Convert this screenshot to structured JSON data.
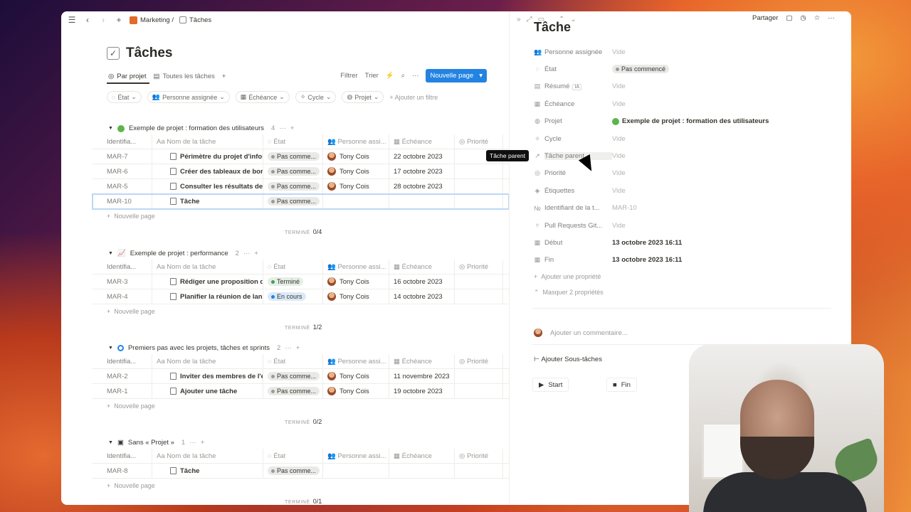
{
  "topbar": {
    "crumb1": "Marketing /",
    "crumb2": "Tâches",
    "share": "Partager"
  },
  "page": {
    "title": "Tâches"
  },
  "views": {
    "tab1": "Par projet",
    "tab2": "Toutes les tâches",
    "filter": "Filtrer",
    "sort": "Trier",
    "new_page": "Nouvelle page"
  },
  "filters": [
    "État",
    "Personne assignée",
    "Échéance",
    "Cycle",
    "Projet"
  ],
  "add_filter": "Ajouter un filtre",
  "columns": {
    "id": "Identifia...",
    "name": "Nom de la tâche",
    "state": "État",
    "person": "Personne assi...",
    "due": "Échéance",
    "priority": "Priorité"
  },
  "new_page_label": "Nouvelle page",
  "done_label": "TERMINÉ",
  "groups": [
    {
      "name": "Exemple de projet : formation des utilisateurs",
      "count": "4",
      "done": "0/4",
      "rows": [
        {
          "id": "MAR-7",
          "name": "Périmètre du projet d'infobu",
          "state": "Pas comme...",
          "person": "Tony Cois",
          "due": "22 octobre 2023"
        },
        {
          "id": "MAR-6",
          "name": "Créer des tableaux de bord",
          "state": "Pas comme...",
          "person": "Tony Cois",
          "due": "17 octobre 2023"
        },
        {
          "id": "MAR-5",
          "name": "Consulter les résultats de la",
          "state": "Pas comme...",
          "person": "Tony Cois",
          "due": "28 octobre 2023"
        },
        {
          "id": "MAR-10",
          "name": "Tâche",
          "state": "Pas comme...",
          "person": "",
          "due": ""
        }
      ]
    },
    {
      "name": "Exemple de projet : performance",
      "count": "2",
      "done": "1/2",
      "rows": [
        {
          "id": "MAR-3",
          "name": "Rédiger une proposition de",
          "state": "Terminé",
          "person": "Tony Cois",
          "due": "16 octobre 2023"
        },
        {
          "id": "MAR-4",
          "name": "Planifier la réunion de lance",
          "state": "En cours",
          "person": "Tony Cois",
          "due": "14 octobre 2023"
        }
      ]
    },
    {
      "name": "Premiers pas avec les projets, tâches et sprints",
      "count": "2",
      "done": "0/2",
      "rows": [
        {
          "id": "MAR-2",
          "name": "Inviter des membres de l'éq",
          "state": "Pas comme...",
          "person": "Tony Cois",
          "due": "11 novembre 2023"
        },
        {
          "id": "MAR-1",
          "name": "Ajouter une tâche",
          "state": "Pas comme...",
          "person": "Tony Cois",
          "due": "19 octobre 2023"
        }
      ]
    },
    {
      "name": "Sans « Projet »",
      "count": "1",
      "done": "0/1",
      "rows": [
        {
          "id": "MAR-8",
          "name": "Tâche",
          "state": "Pas comme...",
          "person": "",
          "due": ""
        }
      ]
    }
  ],
  "panel": {
    "title": "Tâche",
    "props": [
      {
        "label": "Personne assignée",
        "value": "Vide"
      },
      {
        "label": "État",
        "value": "Pas commencé"
      },
      {
        "label": "Résumé",
        "value": "Vide",
        "badge": "IA"
      },
      {
        "label": "Échéance",
        "value": "Vide"
      },
      {
        "label": "Projet",
        "value": "Exemple de projet : formation des utilisateurs"
      },
      {
        "label": "Cycle",
        "value": "Vide"
      },
      {
        "label": "Tâche parent",
        "value": "Vide"
      },
      {
        "label": "Priorité",
        "value": "Vide"
      },
      {
        "label": "Étiquettes",
        "value": "Vide"
      },
      {
        "label": "Identifiant de la t...",
        "value": "MAR-10"
      },
      {
        "label": "Pull Requests Git...",
        "value": "Vide"
      },
      {
        "label": "Début",
        "value": "13 octobre 2023 16:11"
      },
      {
        "label": "Fin",
        "value": "13 octobre 2023 16:11"
      }
    ],
    "add_prop": "Ajouter une propriété",
    "hide_props": "Masquer 2 propriétés",
    "comment_placeholder": "Ajouter un commentaire...",
    "add_sub": "Ajouter Sous-tâches",
    "start": "Start",
    "end": "Fin",
    "tooltip": "Tâche parent"
  }
}
